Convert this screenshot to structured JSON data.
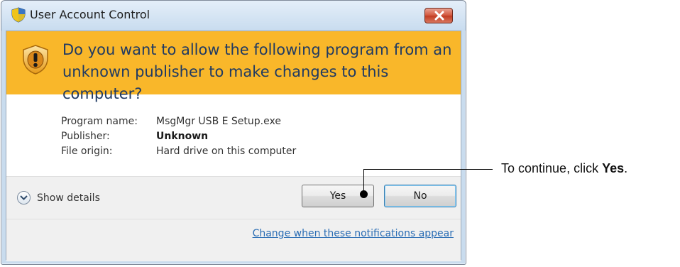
{
  "window": {
    "title": "User Account Control",
    "close_icon": "close-icon"
  },
  "banner": {
    "icon": "warning-shield-icon",
    "question": "Do you want to allow the following program from an unknown publisher to make changes to this computer?"
  },
  "details": {
    "program_label": "Program name:",
    "program_value": "MsgMgr USB E Setup.exe",
    "publisher_label": "Publisher:",
    "publisher_value": "Unknown",
    "origin_label": "File origin:",
    "origin_value": "Hard drive on this computer"
  },
  "footer": {
    "show_details_label": "Show details",
    "yes_label": "Yes",
    "no_label": "No",
    "notifications_link": "Change when these notifications appear"
  },
  "callout": {
    "text_prefix": "To continue, click ",
    "text_bold": "Yes",
    "text_suffix": "."
  },
  "colors": {
    "banner": "#f9b72a",
    "question_text": "#1f3a63",
    "link": "#2a6db4",
    "close_button": "#c23c22"
  }
}
